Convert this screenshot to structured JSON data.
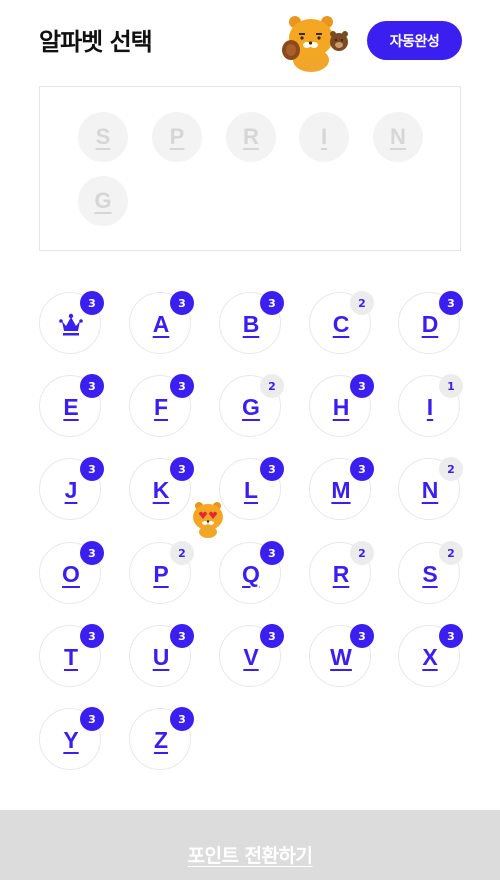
{
  "header": {
    "title": "알파벳 선택",
    "auto_complete_label": "자동완성"
  },
  "selection": {
    "letters": [
      "S",
      "P",
      "R",
      "I",
      "N",
      "G"
    ]
  },
  "keys": [
    {
      "letter": "",
      "icon": "crown-icon",
      "count": "3"
    },
    {
      "letter": "A",
      "count": "3"
    },
    {
      "letter": "B",
      "count": "3"
    },
    {
      "letter": "C",
      "count": "2"
    },
    {
      "letter": "D",
      "count": "3"
    },
    {
      "letter": "E",
      "count": "3"
    },
    {
      "letter": "F",
      "count": "3"
    },
    {
      "letter": "G",
      "count": "2"
    },
    {
      "letter": "H",
      "count": "3"
    },
    {
      "letter": "I",
      "count": "1"
    },
    {
      "letter": "J",
      "count": "3"
    },
    {
      "letter": "K",
      "count": "3"
    },
    {
      "letter": "L",
      "count": "3"
    },
    {
      "letter": "M",
      "count": "3"
    },
    {
      "letter": "N",
      "count": "2"
    },
    {
      "letter": "O",
      "count": "3"
    },
    {
      "letter": "P",
      "count": "2"
    },
    {
      "letter": "Q",
      "count": "3"
    },
    {
      "letter": "R",
      "count": "2"
    },
    {
      "letter": "S",
      "count": "2"
    },
    {
      "letter": "T",
      "count": "3"
    },
    {
      "letter": "U",
      "count": "3"
    },
    {
      "letter": "V",
      "count": "3"
    },
    {
      "letter": "W",
      "count": "3"
    },
    {
      "letter": "X",
      "count": "3"
    },
    {
      "letter": "Y",
      "count": "3"
    },
    {
      "letter": "Z",
      "count": "3"
    }
  ],
  "footer": {
    "convert_points_label": "포인트 전환하기"
  },
  "colors": {
    "accent": "#3b1ff0",
    "badge_low_bg": "#ececec",
    "footer_bg": "#dcdcdc"
  }
}
